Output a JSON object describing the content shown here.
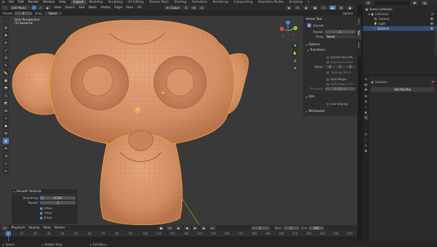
{
  "menubar": {
    "items": [
      "File",
      "Edit",
      "Render",
      "Window",
      "Help"
    ],
    "workspaces": [
      "Layout",
      "Modeling",
      "Sculpting",
      "UV Editing",
      "Texture Paint",
      "Shading",
      "Animation",
      "Rendering",
      "Compositing",
      "Geometry Nodes",
      "Scripting"
    ],
    "active_workspace": "Layout",
    "scene_name": "Scene",
    "view_layer": "ViewLayer"
  },
  "viewport_header": {
    "mode": "Edit Mode",
    "menus": [
      "View",
      "Select",
      "Add",
      "Mesh",
      "Vertex",
      "Edge",
      "Face",
      "UV"
    ],
    "orientation": "Global",
    "options": "Options"
  },
  "tool_header": {
    "repeat_label": "Repeat",
    "repeat_value": "1",
    "drag_label": "Drag",
    "drag_value": "Tweak"
  },
  "viewport": {
    "view_name": "User Perspective",
    "object_label": "(1) Suzanne"
  },
  "active_tool": {
    "section": "Active Tool",
    "tool_name": "Smooth",
    "repeat_label": "Repeat",
    "repeat_value": "1",
    "drag_label": "Drag",
    "drag_value": "Tweak",
    "options": "Options",
    "transform": "Transform",
    "correct_face": "Correct Face Att...",
    "keep_connected": "Keep Connected",
    "mirror_label": "Mirror",
    "mirror_axes": [
      "X",
      "Y",
      "Z"
    ],
    "topology_mirror": "Topology Mirror",
    "auto_merge": "Auto Merge",
    "split_edges": "Split Edges & Fa...",
    "threshold_label": "Threshold",
    "threshold_value": "0.001 m",
    "uvs": "UVs",
    "live_unwrap": "Live Unwrap",
    "workspace": "Workspace"
  },
  "sidebar_tabs": [
    "Item",
    "Tool",
    "View"
  ],
  "last_operator": {
    "title": "Smooth Vertices",
    "smoothing_label": "Smoothing",
    "smoothing_value": "0.116",
    "repeat_label": "Repeat",
    "repeat_value": "1",
    "x_axis": "X-Axis",
    "y_axis": "Y-Axis",
    "z_axis": "Z-Axis"
  },
  "timeline": {
    "menus": [
      "Playback",
      "Keying",
      "View",
      "Marker"
    ],
    "current_frame": "1",
    "start_label": "Start",
    "start_value": "1",
    "end_label": "End",
    "end_value": "250",
    "ticks": [
      "1",
      "10",
      "20",
      "30",
      "40",
      "50",
      "60",
      "70",
      "80",
      "90",
      "100",
      "110",
      "120",
      "130",
      "140",
      "150",
      "160",
      "170",
      "180",
      "190",
      "200",
      "210",
      "220",
      "230",
      "240",
      "250"
    ]
  },
  "statusbar": {
    "select": "Select",
    "rotate": "Rotate View",
    "call_menu": "Call Menu"
  },
  "outliner": {
    "root": "Scene Collection",
    "collection": "Collection",
    "items": [
      "Camera",
      "Light",
      "Suzanne"
    ]
  },
  "properties": {
    "object_name": "Suzanne",
    "add_modifier": "Add Modifier"
  },
  "colors": {
    "accent": "#4a73b5",
    "mesh": "#d9956a",
    "selection": "#ffa733"
  }
}
